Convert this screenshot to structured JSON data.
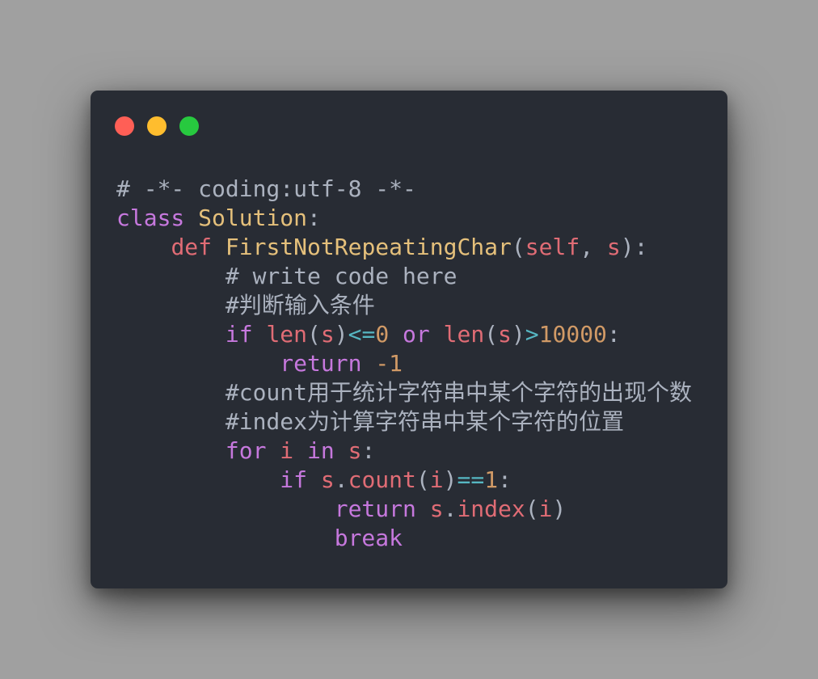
{
  "window": {
    "traffic_lights": [
      {
        "name": "close-button",
        "color": "#ff5f56"
      },
      {
        "name": "minimize-button",
        "color": "#ffbd2e"
      },
      {
        "name": "zoom-button",
        "color": "#27c93f"
      }
    ]
  },
  "colors": {
    "page_background": "#a0a0a0",
    "editor_background": "#282c34",
    "comment": "#abb2bf",
    "keyword": "#c678dd",
    "def_keyword": "#e06c75",
    "class_name": "#e5c07b",
    "function_name": "#e5c07b",
    "builtin": "#e06c75",
    "variable": "#e06c75",
    "operator": "#56b6c2",
    "number": "#d19a66",
    "punctuation": "#abb2bf"
  },
  "code": {
    "lines": [
      {
        "indent": 0,
        "tokens": [
          {
            "t": "# -*- coding:utf-8 -*-",
            "k": "comment"
          }
        ]
      },
      {
        "indent": 0,
        "tokens": [
          {
            "t": "class",
            "k": "keyword"
          },
          {
            "t": " ",
            "k": "punctuation"
          },
          {
            "t": "Solution",
            "k": "class_name"
          },
          {
            "t": ":",
            "k": "punctuation"
          }
        ]
      },
      {
        "indent": 1,
        "tokens": [
          {
            "t": "def",
            "k": "def_keyword"
          },
          {
            "t": " ",
            "k": "punctuation"
          },
          {
            "t": "FirstNotRepeatingChar",
            "k": "function_name"
          },
          {
            "t": "(",
            "k": "punctuation"
          },
          {
            "t": "self",
            "k": "variable"
          },
          {
            "t": ", ",
            "k": "punctuation"
          },
          {
            "t": "s",
            "k": "variable"
          },
          {
            "t": "):",
            "k": "punctuation"
          }
        ]
      },
      {
        "indent": 2,
        "tokens": [
          {
            "t": "# write code here",
            "k": "comment"
          }
        ]
      },
      {
        "indent": 2,
        "tokens": [
          {
            "t": "#判断输入条件",
            "k": "comment"
          }
        ]
      },
      {
        "indent": 2,
        "tokens": [
          {
            "t": "if",
            "k": "keyword"
          },
          {
            "t": " ",
            "k": "punctuation"
          },
          {
            "t": "len",
            "k": "builtin"
          },
          {
            "t": "(",
            "k": "punctuation"
          },
          {
            "t": "s",
            "k": "variable"
          },
          {
            "t": ")",
            "k": "punctuation"
          },
          {
            "t": "<=",
            "k": "operator"
          },
          {
            "t": "0",
            "k": "number"
          },
          {
            "t": " ",
            "k": "punctuation"
          },
          {
            "t": "or",
            "k": "keyword"
          },
          {
            "t": " ",
            "k": "punctuation"
          },
          {
            "t": "len",
            "k": "builtin"
          },
          {
            "t": "(",
            "k": "punctuation"
          },
          {
            "t": "s",
            "k": "variable"
          },
          {
            "t": ")",
            "k": "punctuation"
          },
          {
            "t": ">",
            "k": "operator"
          },
          {
            "t": "10000",
            "k": "number"
          },
          {
            "t": ":",
            "k": "punctuation"
          }
        ]
      },
      {
        "indent": 3,
        "tokens": [
          {
            "t": "return",
            "k": "keyword"
          },
          {
            "t": " ",
            "k": "punctuation"
          },
          {
            "t": "-1",
            "k": "number"
          }
        ]
      },
      {
        "indent": 2,
        "tokens": [
          {
            "t": "#count用于统计字符串中某个字符的出现个数",
            "k": "comment"
          }
        ]
      },
      {
        "indent": 2,
        "tokens": [
          {
            "t": "#index为计算字符串中某个字符的位置",
            "k": "comment"
          }
        ]
      },
      {
        "indent": 2,
        "tokens": [
          {
            "t": "for",
            "k": "keyword"
          },
          {
            "t": " ",
            "k": "punctuation"
          },
          {
            "t": "i",
            "k": "variable"
          },
          {
            "t": " ",
            "k": "punctuation"
          },
          {
            "t": "in",
            "k": "keyword"
          },
          {
            "t": " ",
            "k": "punctuation"
          },
          {
            "t": "s",
            "k": "variable"
          },
          {
            "t": ":",
            "k": "punctuation"
          }
        ]
      },
      {
        "indent": 3,
        "tokens": [
          {
            "t": "if",
            "k": "keyword"
          },
          {
            "t": " ",
            "k": "punctuation"
          },
          {
            "t": "s",
            "k": "variable"
          },
          {
            "t": ".",
            "k": "punctuation"
          },
          {
            "t": "count",
            "k": "builtin"
          },
          {
            "t": "(",
            "k": "punctuation"
          },
          {
            "t": "i",
            "k": "variable"
          },
          {
            "t": ")",
            "k": "punctuation"
          },
          {
            "t": "==",
            "k": "operator"
          },
          {
            "t": "1",
            "k": "number"
          },
          {
            "t": ":",
            "k": "punctuation"
          }
        ]
      },
      {
        "indent": 4,
        "tokens": [
          {
            "t": "return",
            "k": "keyword"
          },
          {
            "t": " ",
            "k": "punctuation"
          },
          {
            "t": "s",
            "k": "variable"
          },
          {
            "t": ".",
            "k": "punctuation"
          },
          {
            "t": "index",
            "k": "builtin"
          },
          {
            "t": "(",
            "k": "punctuation"
          },
          {
            "t": "i",
            "k": "variable"
          },
          {
            "t": ")",
            "k": "punctuation"
          }
        ]
      },
      {
        "indent": 4,
        "tokens": [
          {
            "t": "break",
            "k": "keyword"
          }
        ]
      }
    ]
  }
}
